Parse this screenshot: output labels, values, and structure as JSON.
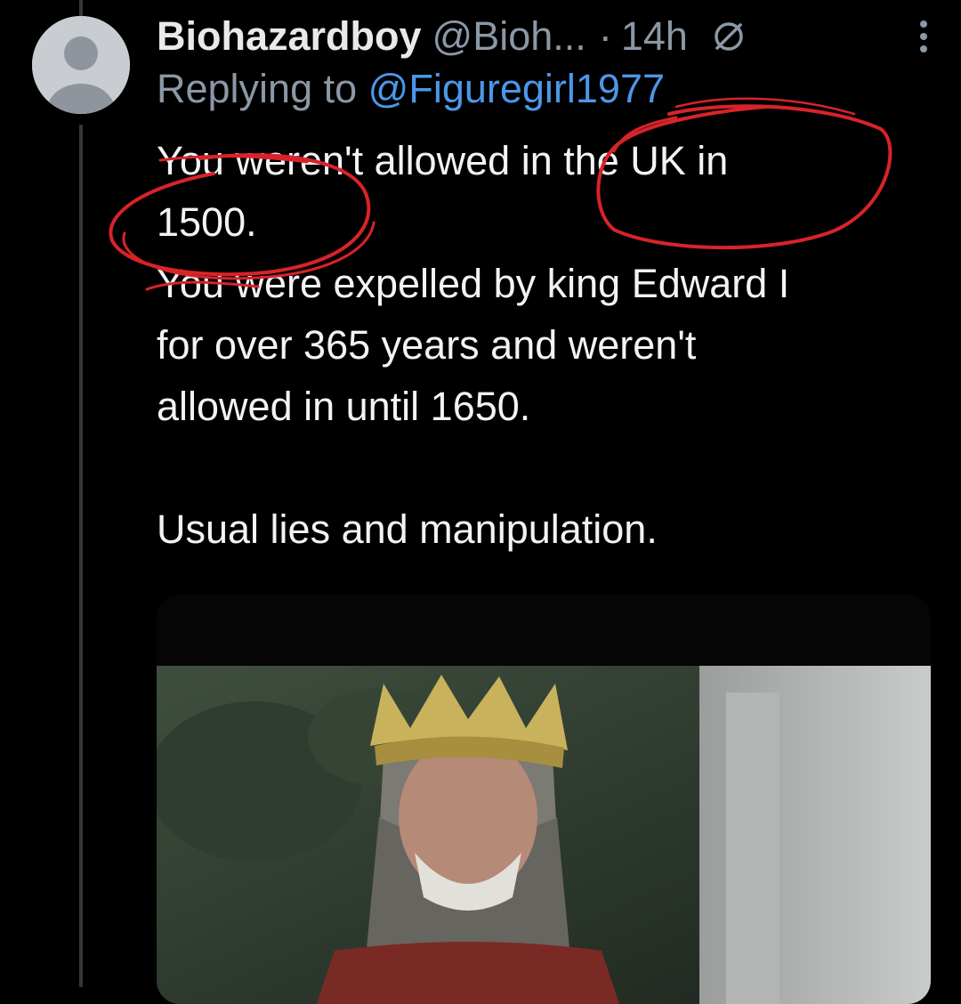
{
  "tweet": {
    "display_name": "Biohazardboy",
    "handle": "@Bioh...",
    "separator": "·",
    "timestamp": "14h",
    "replying_to_label": "Replying to",
    "replying_to_handle": "@Figuregirl1977",
    "text_lines": [
      "You weren't allowed in the UK in",
      "1500.",
      "You were expelled by king Edward I",
      "for over 365 years and weren't",
      "allowed in until 1650.",
      "",
      "Usual lies and manipulation."
    ]
  },
  "icons": {
    "avatar": "default-avatar-icon",
    "muted": "muted-icon",
    "more": "more-options-icon"
  },
  "colors": {
    "background": "#000000",
    "text": "#e7e9ea",
    "secondary": "#8b98a5",
    "mention": "#4c97e8",
    "annotation": "#d8232a"
  }
}
